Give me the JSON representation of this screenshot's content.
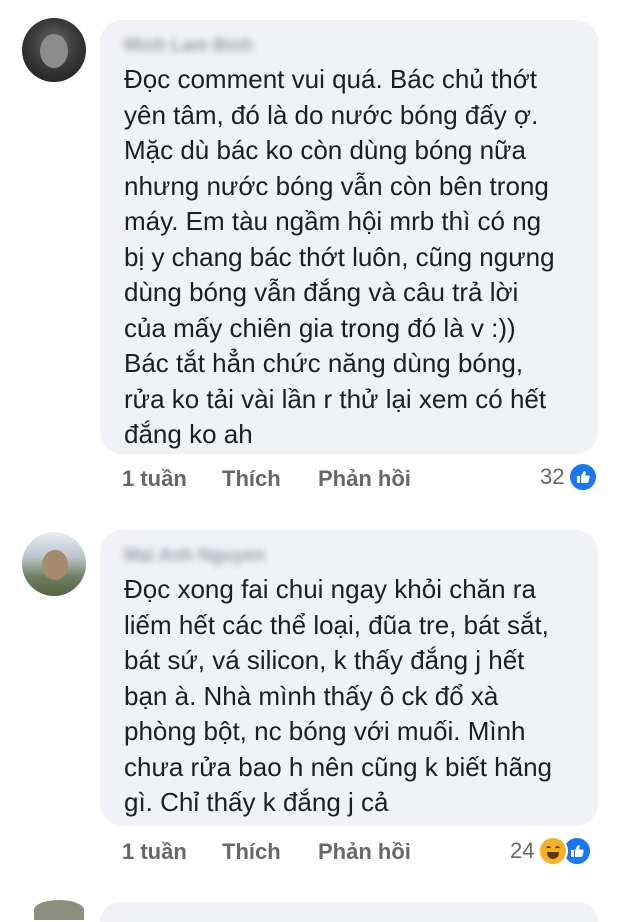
{
  "comments": [
    {
      "author": "Minh Lam Binh",
      "text": "Đọc comment vui quá. Bác chủ thớt\nyên tâm, đó là do nước bóng đấy ợ.\nMặc dù bác ko còn dùng bóng nữa\nnhưng nước bóng vẫn còn bên trong\nmáy. Em tàu ngầm hội mrb thì có ng\nbị y chang bác thớt luôn, cũng ngưng\ndùng bóng vẫn đắng và câu trả lời\ncủa mấy chiên gia trong đó là v :))\nBác tắt hẳn chức năng dùng bóng,\nrửa ko tải vài lần r thử lại xem có hết\nđắng ko ah",
      "time": "1 tuần",
      "like_label": "Thích",
      "reply_label": "Phản hồi",
      "reaction_count": "32",
      "reactions": [
        "like-icon"
      ]
    },
    {
      "author": "Mai Anh Nguyen",
      "text": "Đọc xong fai chui ngay khỏi chăn ra\nliếm hết các thể loại, đũa tre, bát sắt,\nbát sứ, vá silicon, k thấy đắng j hết\nbạn à. Nhà mình thấy ô ck đổ xà\nphòng bột, nc bóng với muối. Mình\nchưa rửa bao h nên cũng k biết hãng\ngì. Chỉ thấy k đắng j cả",
      "time": "1 tuần",
      "like_label": "Thích",
      "reply_label": "Phản hồi",
      "reaction_count": "24",
      "reactions": [
        "haha-icon",
        "like-icon"
      ]
    }
  ],
  "colors": {
    "bubble": "#f0f2f5",
    "text": "#1c1e21",
    "meta": "#65676b",
    "like_blue": "#1877f2",
    "haha_yellow": "#f7b125"
  }
}
